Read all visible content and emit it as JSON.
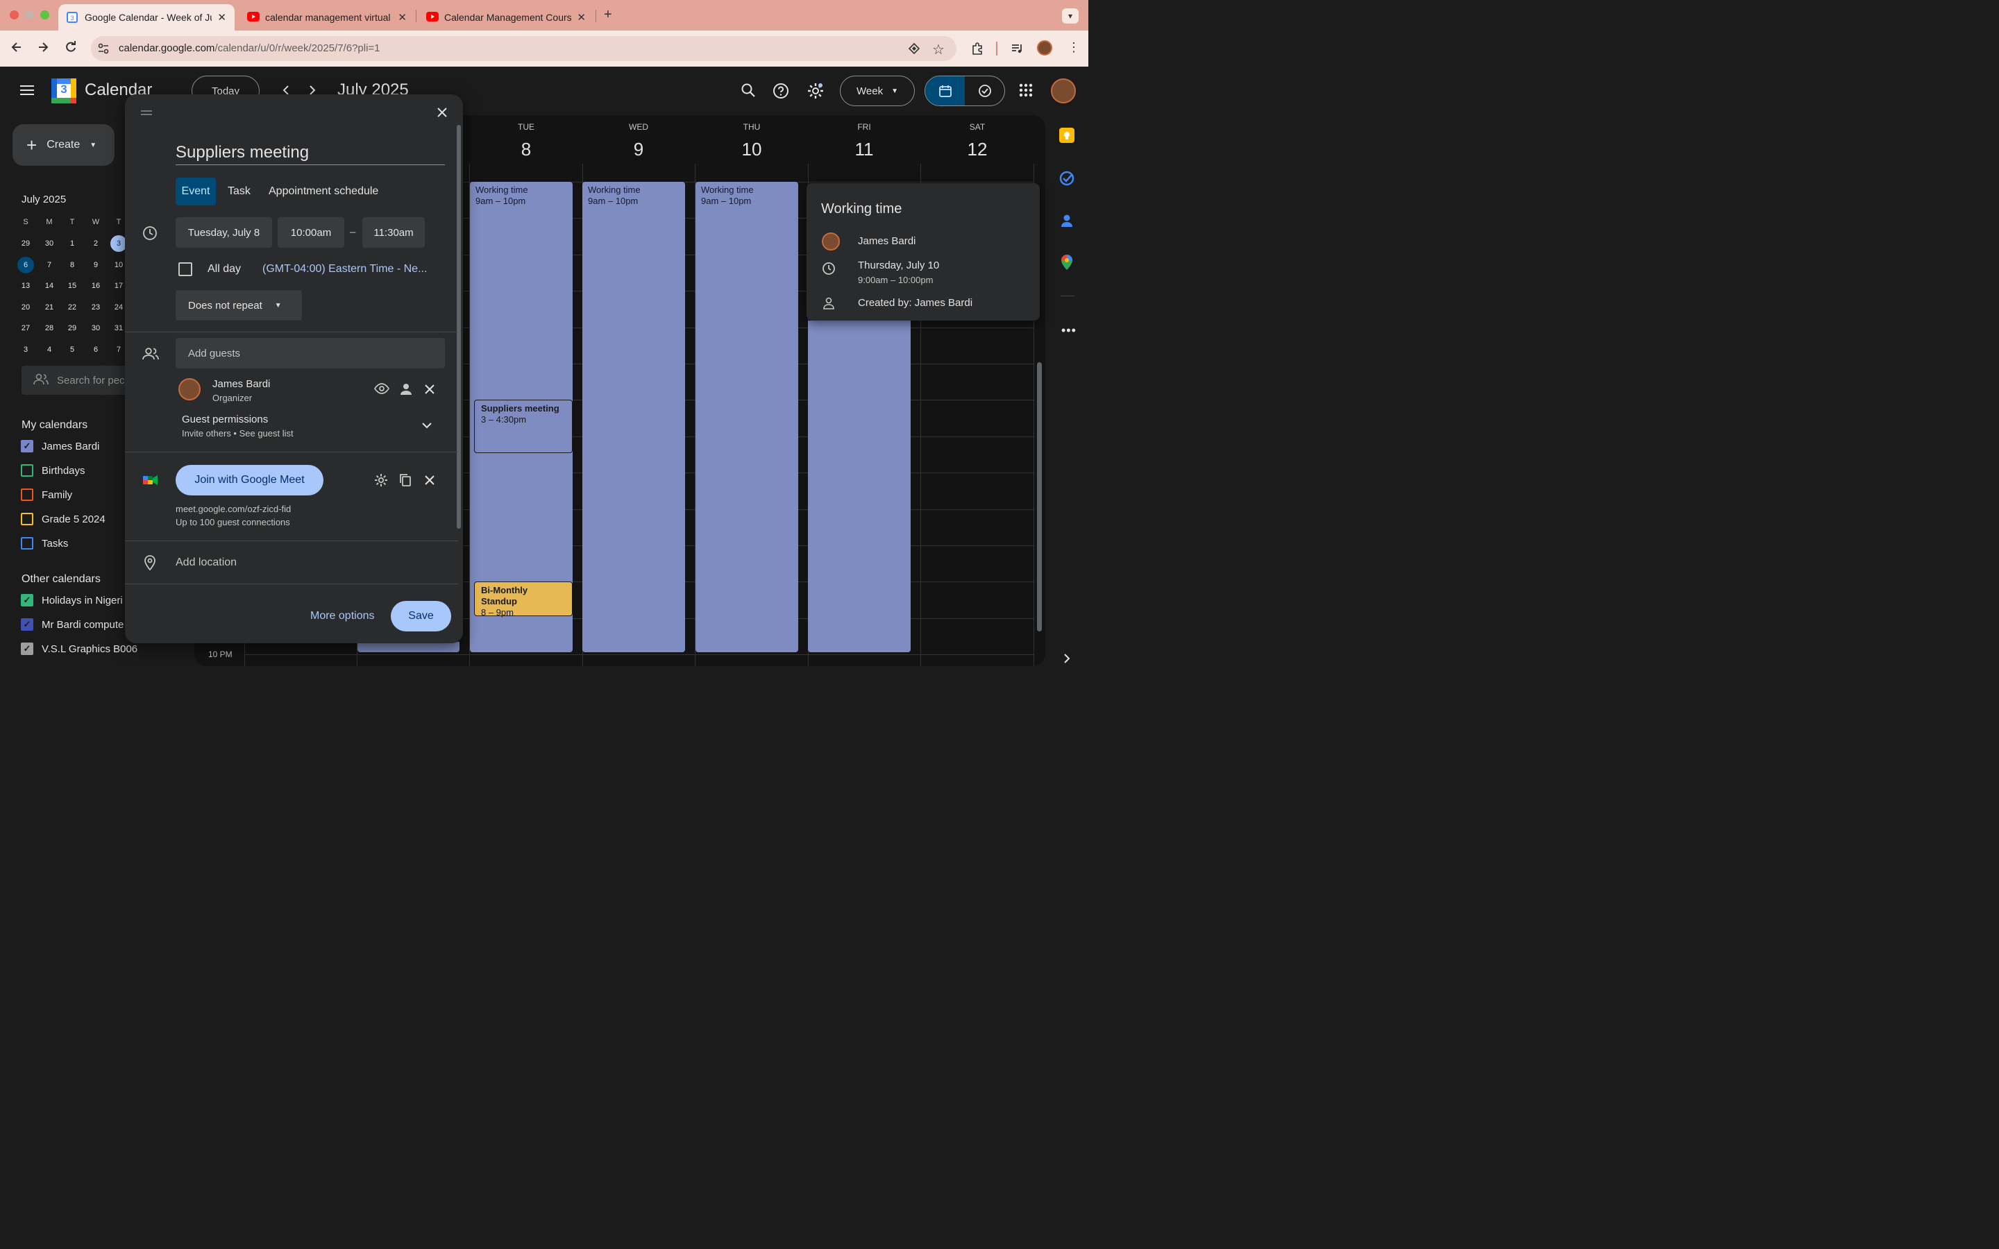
{
  "browser": {
    "tabs": [
      {
        "title": "Google Calendar - Week of Ju",
        "favicon_color": "#4285f4"
      },
      {
        "title": "calendar management virtual",
        "favicon_color": "#ff0000"
      },
      {
        "title": "Calendar Management Cours",
        "favicon_color": "#ff0000"
      }
    ],
    "url_host": "calendar.google.com",
    "url_path": "/calendar/u/0/r/week/2025/7/6?pli=1",
    "new_tab_symbol": "+"
  },
  "header": {
    "app_name": "Calendar",
    "logo_day": "3",
    "today_label": "Today",
    "month_title": "July 2025",
    "view_label": "Week"
  },
  "sidebar": {
    "create_label": "Create",
    "mini_month": "July 2025",
    "dow": [
      "S",
      "M",
      "T",
      "W",
      "T"
    ],
    "weeks": [
      [
        "29",
        "30",
        "1",
        "2",
        "3"
      ],
      [
        "6",
        "7",
        "8",
        "9",
        "10"
      ],
      [
        "13",
        "14",
        "15",
        "16",
        "17"
      ],
      [
        "20",
        "21",
        "22",
        "23",
        "24"
      ],
      [
        "27",
        "28",
        "29",
        "30",
        "31"
      ],
      [
        "3",
        "4",
        "5",
        "6",
        "7"
      ]
    ],
    "search_placeholder": "Search for pec",
    "my_calendars_label": "My calendars",
    "my_calendars": [
      {
        "name": "James Bardi",
        "color": "#7986cb",
        "checked": true
      },
      {
        "name": "Birthdays",
        "color": "#33b679",
        "checked": false
      },
      {
        "name": "Family",
        "color": "#f4511e",
        "checked": false
      },
      {
        "name": "Grade 5 2024",
        "color": "#f6bf26",
        "checked": false
      },
      {
        "name": "Tasks",
        "color": "#4285f4",
        "checked": false
      }
    ],
    "other_calendars_label": "Other calendars",
    "other_calendars": [
      {
        "name": "Holidays in Nigeri",
        "color": "#33b679",
        "checked": true
      },
      {
        "name": "Mr Bardi compute",
        "color": "#3f51b5",
        "checked": true
      },
      {
        "name": "V.S.L Graphics B006",
        "color": "#9e9e9e",
        "checked": true
      }
    ]
  },
  "grid": {
    "days": [
      {
        "dow": "TUE",
        "num": "8"
      },
      {
        "dow": "WED",
        "num": "9"
      },
      {
        "dow": "THU",
        "num": "10"
      },
      {
        "dow": "FRI",
        "num": "11"
      },
      {
        "dow": "SAT",
        "num": "12"
      }
    ],
    "time_label": "10 PM",
    "working_time_title": "Working time",
    "working_time_range": "9am – 10pm",
    "events": {
      "suppliers_title": "Suppliers meeting",
      "suppliers_time": "3 – 4:30pm",
      "standup_title": "Bi-Monthly Standup",
      "standup_time": "8 – 9pm"
    }
  },
  "dialog": {
    "title": "Suppliers meeting",
    "tabs": [
      "Event",
      "Task",
      "Appointment schedule"
    ],
    "date": "Tuesday, July 8",
    "start_time": "10:00am",
    "dash": "–",
    "end_time": "11:30am",
    "all_day_label": "All day",
    "timezone": "(GMT-04:00) Eastern Time - Ne...",
    "repeat": "Does not repeat",
    "add_guests_placeholder": "Add guests",
    "guest_name": "James Bardi",
    "guest_role": "Organizer",
    "guest_permissions": "Guest permissions",
    "guest_permissions_sub": "Invite others • See guest list",
    "meet_button": "Join with Google Meet",
    "meet_link": "meet.google.com/ozf-zicd-fid",
    "meet_limit": "Up to 100 guest connections",
    "add_location": "Add location",
    "more_options": "More options",
    "save": "Save"
  },
  "popover": {
    "title": "Working time",
    "person": "James Bardi",
    "date": "Thursday, July 10",
    "time": "9:00am – 10:00pm",
    "created_by": "Created by: James Bardi"
  },
  "colors": {
    "accent": "#a8c7fa",
    "working_time": "#7f8cc2",
    "standup": "#e6b955"
  }
}
